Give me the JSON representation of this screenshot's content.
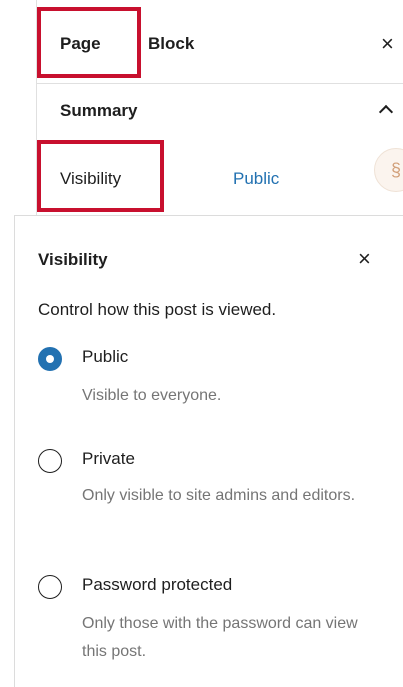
{
  "tabs": {
    "page_label": "Page",
    "block_label": "Block",
    "close_glyph": "×"
  },
  "summary": {
    "label": "Summary"
  },
  "visibility_row": {
    "label": "Visibility",
    "value": "Public",
    "value_color": "#2271b1"
  },
  "avatar": {
    "glyph": "§"
  },
  "popover": {
    "title": "Visibility",
    "close_glyph": "×",
    "description": "Control how this post is viewed.",
    "options": [
      {
        "label": "Public",
        "help": "Visible to everyone.",
        "selected": true
      },
      {
        "label": "Private",
        "help": "Only visible to site admins and editors.",
        "selected": false
      },
      {
        "label": "Password protected",
        "help": "Only those with the password can view this post.",
        "selected": false
      }
    ]
  },
  "colors": {
    "highlight": "#c8102e",
    "accent": "#2271b1",
    "muted_text": "#757575"
  }
}
